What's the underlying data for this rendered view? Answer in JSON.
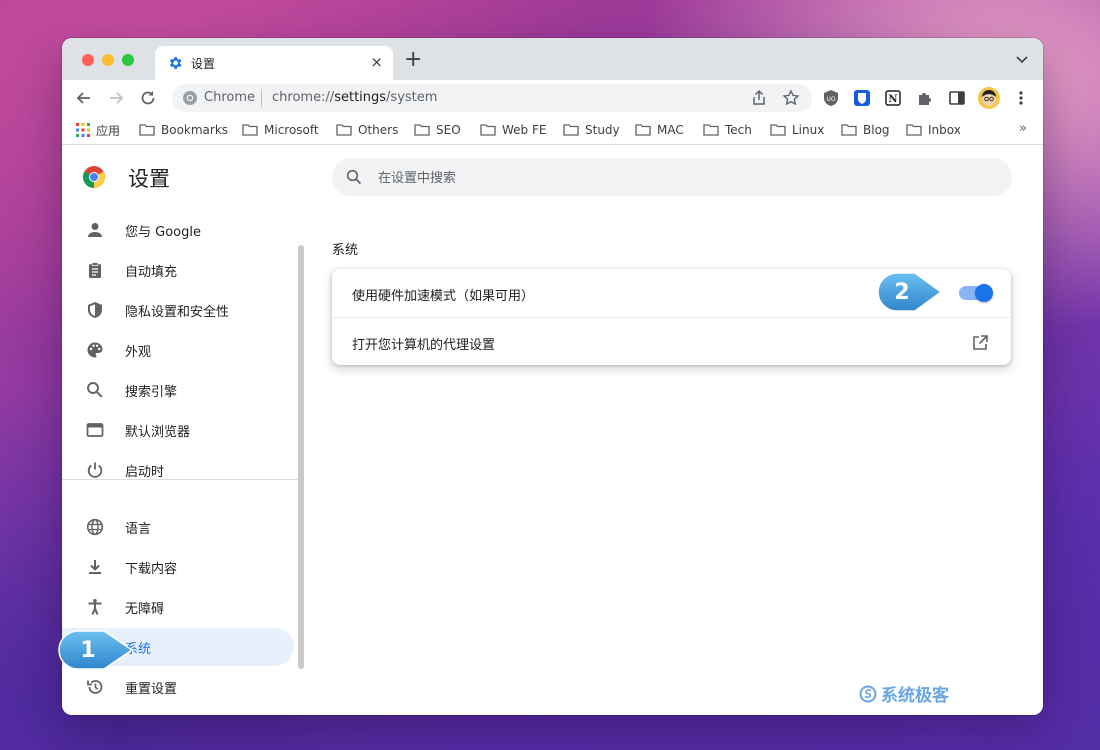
{
  "tab": {
    "title": "设置",
    "close": "×"
  },
  "toolbar": {
    "omnibox_scheme": "Chrome",
    "omnibox_url_prefix": "chrome://",
    "omnibox_url_path": "settings",
    "omnibox_url_suffix": "/system"
  },
  "bookmarks": {
    "items": [
      {
        "label": "应用",
        "icon": "apps-grid-icon"
      },
      {
        "label": "Bookmarks",
        "icon": "folder-icon"
      },
      {
        "label": "Microsoft",
        "icon": "folder-icon"
      },
      {
        "label": "Others",
        "icon": "folder-icon"
      },
      {
        "label": "SEO",
        "icon": "folder-icon"
      },
      {
        "label": "Web FE",
        "icon": "folder-icon"
      },
      {
        "label": "Study",
        "icon": "folder-icon"
      },
      {
        "label": "MAC",
        "icon": "folder-icon"
      },
      {
        "label": "Tech",
        "icon": "folder-icon"
      },
      {
        "label": "Linux",
        "icon": "folder-icon"
      },
      {
        "label": "Blog",
        "icon": "folder-icon"
      },
      {
        "label": "Inbox",
        "icon": "folder-icon"
      }
    ],
    "more": "»"
  },
  "settings": {
    "title": "设置",
    "search_placeholder": "在设置中搜索",
    "sidebar": [
      {
        "label": "您与 Google",
        "icon": "person-icon"
      },
      {
        "label": "自动填充",
        "icon": "clipboard-icon"
      },
      {
        "label": "隐私设置和安全性",
        "icon": "shield-icon"
      },
      {
        "label": "外观",
        "icon": "palette-icon"
      },
      {
        "label": "搜索引擎",
        "icon": "search-icon"
      },
      {
        "label": "默认浏览器",
        "icon": "browser-icon"
      },
      {
        "label": "启动时",
        "icon": "power-icon"
      },
      {
        "label": "语言",
        "icon": "globe-icon"
      },
      {
        "label": "下载内容",
        "icon": "download-icon"
      },
      {
        "label": "无障碍",
        "icon": "accessibility-icon"
      },
      {
        "label": "系统",
        "icon": "wrench-icon",
        "active": true
      },
      {
        "label": "重置设置",
        "icon": "history-icon"
      }
    ],
    "section_title": "系统",
    "rows": [
      {
        "label": "使用硬件加速模式（如果可用）",
        "control": "toggle",
        "enabled": true
      },
      {
        "label": "打开您计算机的代理设置",
        "control": "open-in-new"
      }
    ]
  },
  "callouts": [
    "1",
    "2"
  ],
  "watermark": "系统极客",
  "colors": {
    "accent": "#1a73e8",
    "callout": "#3d9ad8",
    "active_bg": "#e8f0fe"
  }
}
